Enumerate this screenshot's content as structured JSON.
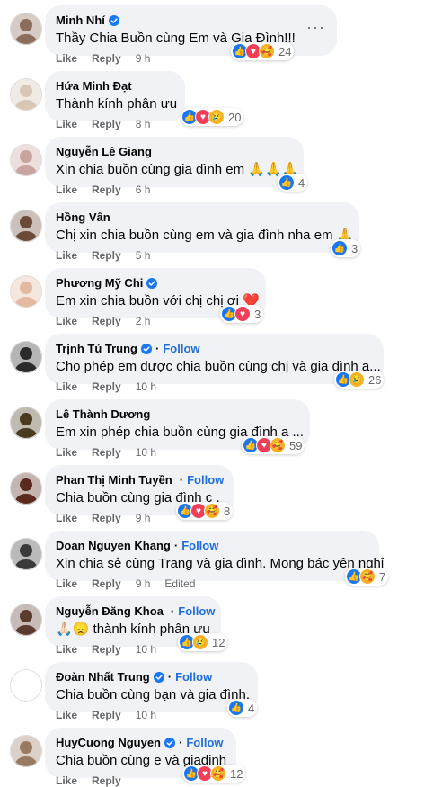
{
  "labels": {
    "like": "Like",
    "reply": "Reply",
    "edited": "Edited",
    "follow": "Follow",
    "more": "···"
  },
  "comments": [
    {
      "name": "Minh Nhí",
      "verified": true,
      "follow": false,
      "text": "Thầy Chia Buồn cùng Em và Gia Đình!!!",
      "time": "9 h",
      "reactions": [
        "like",
        "love",
        "care"
      ],
      "count": "24"
    },
    {
      "name": "Hứa Minh Đạt",
      "verified": false,
      "follow": false,
      "text": "Thành kính phân ưu",
      "time": "8 h",
      "reactions": [
        "like",
        "love",
        "sad"
      ],
      "count": "20"
    },
    {
      "name": "Nguyễn Lê Giang",
      "verified": false,
      "follow": false,
      "text": "Xin chia buồn cùng gia đình em 🙏🙏🙏",
      "time": "6 h",
      "reactions": [
        "like"
      ],
      "count": "4"
    },
    {
      "name": "Hồng Vân",
      "verified": false,
      "follow": false,
      "text": "Chị xin chia buồn cùng em và gia đình nha em 🙏",
      "time": "5 h",
      "reactions": [
        "like"
      ],
      "count": "3"
    },
    {
      "name": "Phương Mỹ Chi",
      "verified": true,
      "follow": false,
      "text": "Em xin chia buồn với chị chị ơi ❤️",
      "time": "2 h",
      "reactions": [
        "like",
        "love"
      ],
      "count": "3"
    },
    {
      "name": "Trịnh Tú Trung",
      "verified": true,
      "follow": true,
      "text": "Cho phép em được chia buồn cùng chị và gia đình ạ...",
      "time": "10 h",
      "reactions": [
        "like",
        "sad"
      ],
      "count": "26"
    },
    {
      "name": "Lê Thành Dương",
      "verified": false,
      "follow": false,
      "text": "Em xin phép chia buồn cùng gia đình ạ ...",
      "time": "10 h",
      "reactions": [
        "like",
        "love",
        "care"
      ],
      "count": "59"
    },
    {
      "name": "Phan Thị Minh Tuyền",
      "verified": true,
      "follow": true,
      "text": "Chia buồn cùng gia đình c .",
      "time": "9 h",
      "reactions": [
        "like",
        "love",
        "care"
      ],
      "count": "8"
    },
    {
      "name": "Doan Nguyen Khang",
      "verified": false,
      "follow": true,
      "text": "Xin chia sẻ cùng Trang và gia đình. Mong bác yên nghỉ",
      "time": "9 h",
      "edited": true,
      "reactions": [
        "like",
        "care"
      ],
      "count": "7"
    },
    {
      "name": "Nguyễn Đăng Khoa",
      "verified": true,
      "follow": true,
      "text": "🙏🏻😞 thành kính phân ưu",
      "time": "10 h",
      "reactions": [
        "like",
        "sad"
      ],
      "count": "12"
    },
    {
      "name": "Đoàn Nhất Trung",
      "verified": true,
      "follow": true,
      "text": "Chia buồn cùng bạn và gia đình.",
      "time": "10 h",
      "reactions": [
        "like"
      ],
      "count": "4"
    },
    {
      "name": "HuyCuong Nguyen",
      "verified": true,
      "follow": true,
      "text": "Chia buồn cùng e và giadinh",
      "time": "",
      "reactions": [
        "like",
        "love",
        "care"
      ],
      "count": "12"
    }
  ],
  "colors": {
    "accent": "#216fdb",
    "bubble": "#f0f2f5",
    "meta": "#65676b",
    "like": "#1877f2",
    "love": "#f33e58",
    "yellow": "#f7b125"
  }
}
